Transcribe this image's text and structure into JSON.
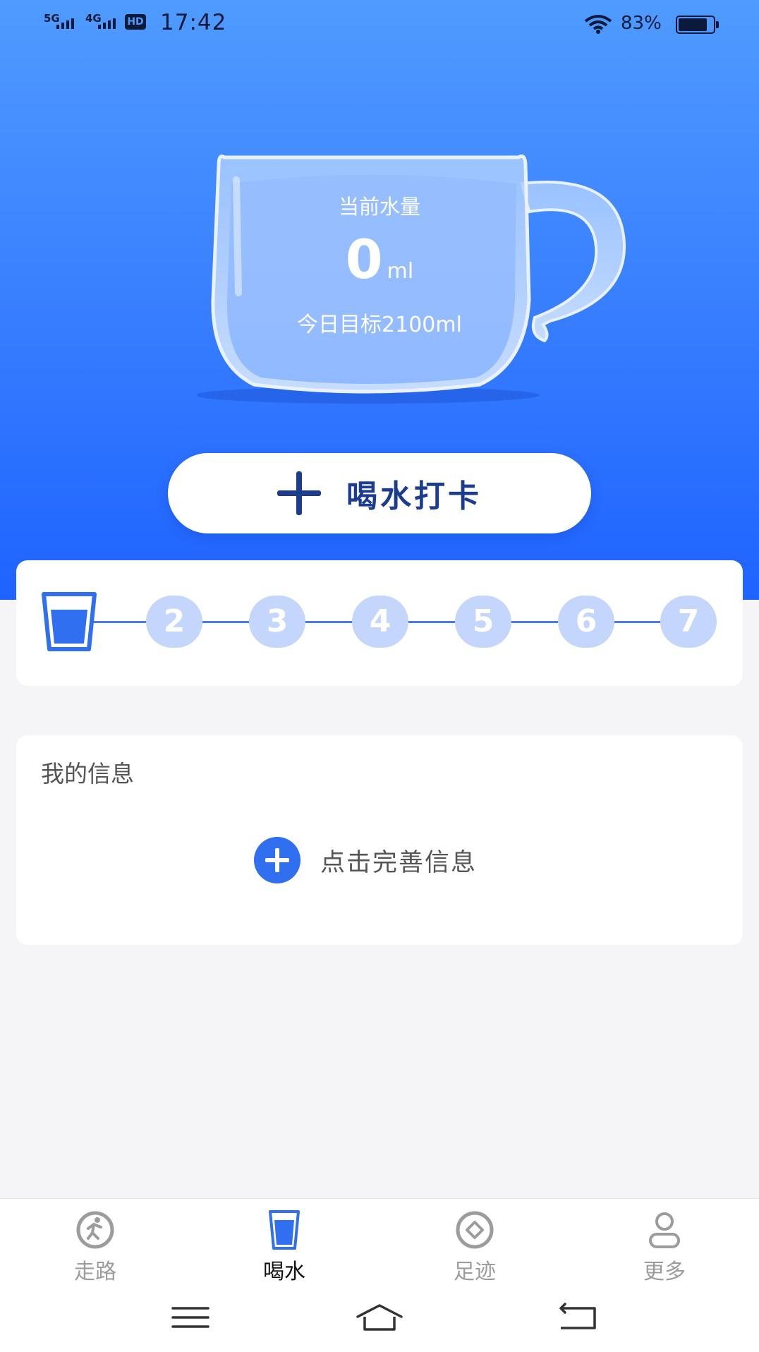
{
  "status_bar": {
    "sig1": "5G",
    "sig2": "4G",
    "hd": "HD",
    "time": "17:42",
    "battery": "83%"
  },
  "cup": {
    "label": "当前水量",
    "value": "0",
    "unit": "ml",
    "goal": "今日目标2100ml"
  },
  "checkin_button": {
    "label": "喝水打卡"
  },
  "progress": {
    "current_step": 1,
    "steps": [
      "2",
      "3",
      "4",
      "5",
      "6",
      "7"
    ]
  },
  "info": {
    "title": "我的信息",
    "add_label": "点击完善信息"
  },
  "tabs": [
    {
      "label": "走路",
      "icon": "walk-icon"
    },
    {
      "label": "喝水",
      "icon": "cup-icon",
      "active": true
    },
    {
      "label": "足迹",
      "icon": "footprint-icon"
    },
    {
      "label": "更多",
      "icon": "person-icon"
    }
  ],
  "colors": {
    "accent": "#2f6ff0",
    "hero_top": "#4f9bff",
    "hero_bottom": "#1e63ff",
    "step_inactive": "#c4d6fb"
  }
}
